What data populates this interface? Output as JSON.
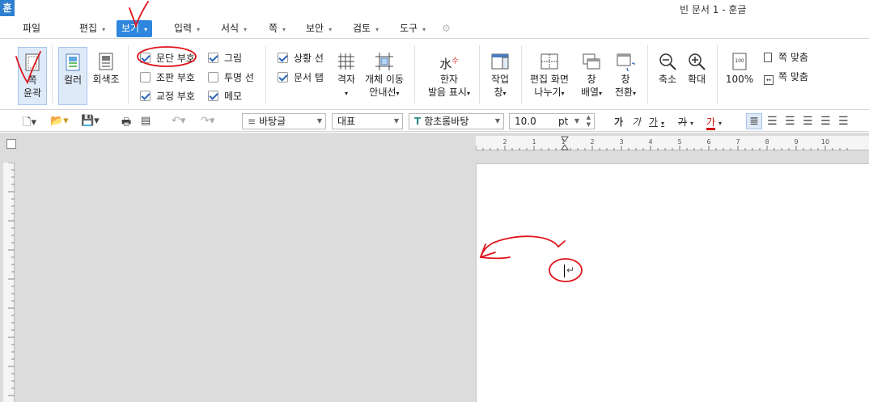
{
  "window": {
    "title": "빈 문서 1 - 훈글",
    "app_icon": "훈"
  },
  "menu": {
    "items": [
      {
        "label": "파일"
      },
      {
        "label": "편집"
      },
      {
        "label": "보기"
      },
      {
        "label": "입력"
      },
      {
        "label": "서식"
      },
      {
        "label": "쪽"
      },
      {
        "label": "보안"
      },
      {
        "label": "검토"
      },
      {
        "label": "도구"
      }
    ]
  },
  "ribbon": {
    "page_outline_line1": "쪽",
    "page_outline_line2": "윤곽",
    "color": "컬러",
    "grayscale": "회색조",
    "checkboxes": {
      "para_mark": "문단 부호",
      "image": "그림",
      "layout_mark": "조판 부호",
      "transparent_line": "투명 선",
      "proof_mark": "교정 부호",
      "memo": "메모",
      "status_line": "상황 선",
      "doc_tab": "문서 탭"
    },
    "grid": "격자",
    "object_move_line1": "개체 이동",
    "object_move_line2": "안내선",
    "hanja_line1": "한자",
    "hanja_line2": "발음 표시",
    "work_window_line1": "작업",
    "work_window_line2": "창",
    "split_line1": "편집 화면",
    "split_line2": "나누기",
    "arrange_line1": "창",
    "arrange_line2": "배열",
    "switch_line1": "창",
    "switch_line2": "전환",
    "zoom_out": "축소",
    "zoom_in": "확대",
    "zoom_level": "100%",
    "fit_width": "쪽 맞춤",
    "fit_page": "쪽 맞춤"
  },
  "format": {
    "style": "바탕글",
    "lang": "대표",
    "font": "함초롬바탕",
    "size": "10.0",
    "unit": "pt",
    "char_bold": "가",
    "char_italic": "가",
    "char_underline": "가",
    "char_strike": "가",
    "char_color": "가"
  },
  "ruler": {
    "h_labels": [
      "2",
      "1",
      "1",
      "2",
      "3",
      "4",
      "5",
      "6",
      "7",
      "8",
      "9",
      "10"
    ]
  },
  "colors": {
    "accent": "#2e86de",
    "annotation": "#e0141b"
  }
}
